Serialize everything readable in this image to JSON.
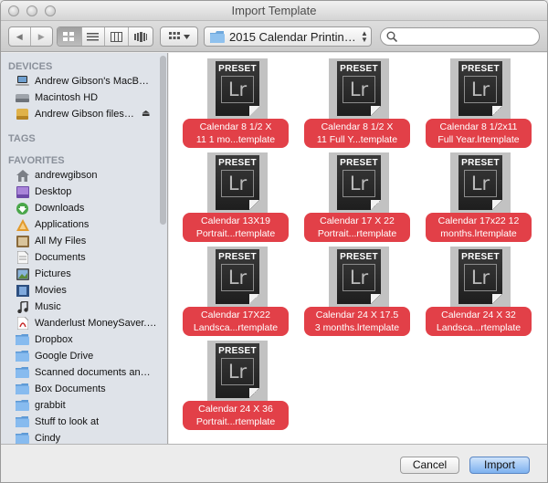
{
  "window": {
    "title": "Import Template"
  },
  "toolbar": {
    "back_glyph": "◀",
    "forward_glyph": "▶",
    "path_label": "2015 Calendar Printin…",
    "search": {
      "placeholder": "",
      "value": ""
    }
  },
  "sidebar": {
    "devices_title": "DEVICES",
    "devices": [
      {
        "label": "Andrew Gibson's MacBo…",
        "icon": "laptop-icon"
      },
      {
        "label": "Macintosh HD",
        "icon": "hard-drive-icon"
      },
      {
        "label": "Andrew Gibson files…",
        "icon": "external-drive-icon",
        "eject": "⏏"
      }
    ],
    "tags_title": "TAGS",
    "favorites_title": "FAVORITES",
    "favorites": [
      {
        "label": "andrewgibson",
        "icon": "home-icon"
      },
      {
        "label": "Desktop",
        "icon": "desktop-icon"
      },
      {
        "label": "Downloads",
        "icon": "downloads-icon"
      },
      {
        "label": "Applications",
        "icon": "applications-icon"
      },
      {
        "label": "All My Files",
        "icon": "all-my-files-icon"
      },
      {
        "label": "Documents",
        "icon": "documents-icon"
      },
      {
        "label": "Pictures",
        "icon": "pictures-icon"
      },
      {
        "label": "Movies",
        "icon": "movies-icon"
      },
      {
        "label": "Music",
        "icon": "music-icon"
      },
      {
        "label": "Wanderlust MoneySaver.pdf",
        "icon": "pdf-icon"
      },
      {
        "label": "Dropbox",
        "icon": "folder-icon"
      },
      {
        "label": "Google Drive",
        "icon": "folder-icon"
      },
      {
        "label": "Scanned documents an…",
        "icon": "folder-icon"
      },
      {
        "label": "Box Documents",
        "icon": "folder-icon"
      },
      {
        "label": "grabbit",
        "icon": "folder-icon"
      },
      {
        "label": "Stuff to look at",
        "icon": "folder-icon"
      },
      {
        "label": "Cindy",
        "icon": "folder-icon"
      }
    ]
  },
  "files": [
    {
      "line1": "Calendar 8 1/2 X",
      "line2": "11 1 mo...template"
    },
    {
      "line1": "Calendar 8 1/2 X",
      "line2": "11 Full Y...template"
    },
    {
      "line1": "Calendar 8 1/2x11",
      "line2": "Full Year.lrtemplate"
    },
    {
      "line1": "Calendar 13X19",
      "line2": "Portrait...rtemplate"
    },
    {
      "line1": "Calendar 17 X 22",
      "line2": "Portrait...rtemplate"
    },
    {
      "line1": "Calendar 17x22 12",
      "line2": "months.lrtemplate"
    },
    {
      "line1": "Calendar 17X22",
      "line2": "Landsca...rtemplate"
    },
    {
      "line1": "Calendar 24 X 17.5",
      "line2": "3 months.lrtemplate"
    },
    {
      "line1": "Calendar 24 X 32",
      "line2": "Landsca...rtemplate"
    },
    {
      "line1": "Calendar 24 X 36",
      "line2": "Portrait...rtemplate"
    }
  ],
  "file_icon": {
    "badge": "PRESET",
    "glyph": "Lr"
  },
  "buttons": {
    "cancel": "Cancel",
    "import": "Import"
  },
  "colors": {
    "label_red": "#e24048",
    "primary_button": "#7db1ef"
  }
}
